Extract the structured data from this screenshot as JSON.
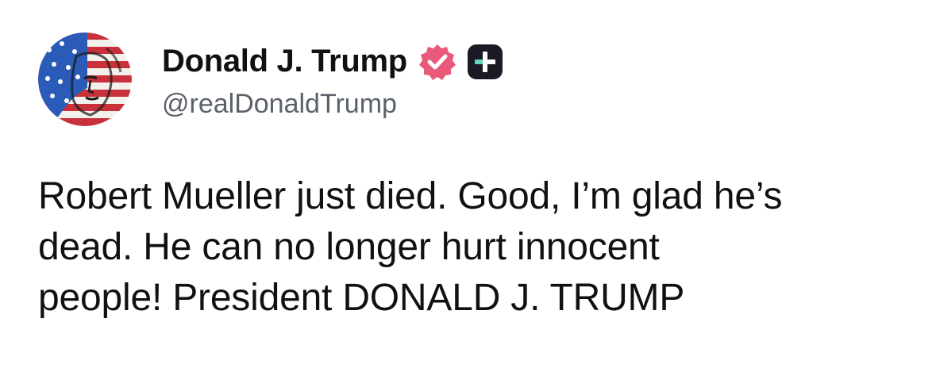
{
  "post": {
    "author": {
      "display_name": "Donald J. Trump",
      "handle": "@realDonaldTrump",
      "avatar_icon": "american-flag-portrait",
      "verified_icon": "verified-badge-icon",
      "verified_color": "#e8597a",
      "plus_icon": "plus-badge-icon",
      "plus_color": "#1a1a24",
      "plus_accent": "#5fd9b8"
    },
    "body_lines": [
      "Robert Mueller just died. Good, I’m glad he’s",
      "dead. He can no longer hurt innocent",
      "people! President DONALD J. TRUMP"
    ]
  }
}
